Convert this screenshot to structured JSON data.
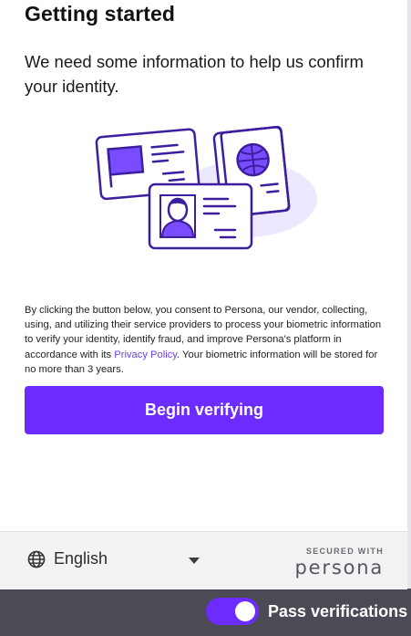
{
  "header": {
    "title": "Getting started",
    "subtitle": "We need some information to help us confirm your identity."
  },
  "illustration": {
    "icon": "id-documents-illustration",
    "accent": "#3c1e9e",
    "highlight": "#7a4cff",
    "backdrop": "#ece8ff"
  },
  "consent": {
    "before_link": "By clicking the button below, you consent to Persona, our vendor, collecting, using, and utilizing their service providers to process your biometric information to verify your identity, identify fraud, and improve Persona's platform in accordance with its ",
    "link": "Privacy Policy",
    "after_link": ". Your biometric information will be stored for no more than 3 years."
  },
  "primary_button": {
    "label": "Begin verifying",
    "color": "#6c2bff"
  },
  "footer": {
    "language": {
      "icon": "globe-icon",
      "selected": "English"
    },
    "secured_label": "SECURED WITH",
    "brand": "persona"
  },
  "toggle": {
    "label": "Pass verifications",
    "on": true,
    "color": "#6c2bff"
  }
}
